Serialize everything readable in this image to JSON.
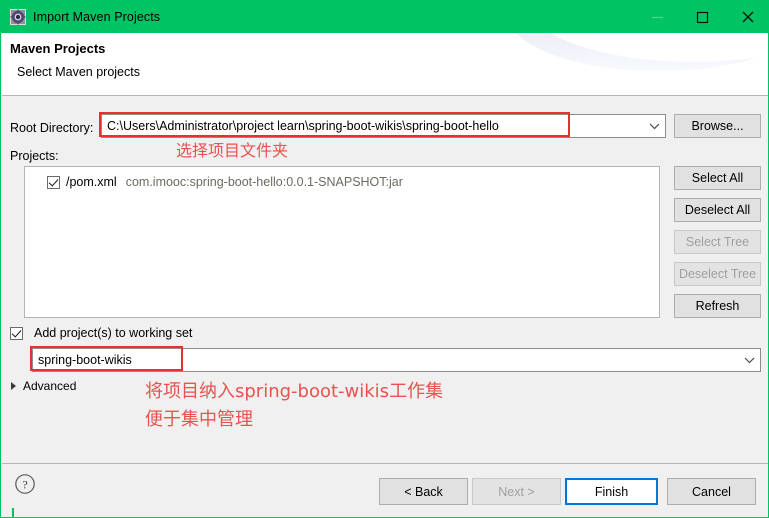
{
  "window": {
    "title": "Import Maven Projects",
    "icon": "maven-gear-icon",
    "accent_color": "#00c364",
    "controls": {
      "minimize": "–",
      "maximize": "□",
      "close": "×"
    }
  },
  "header": {
    "title": "Maven Projects",
    "subtitle": "Select Maven projects"
  },
  "form": {
    "root_directory_label": "Root Directory:",
    "root_directory_value": "C:\\Users\\Administrator\\project learn\\spring-boot-wikis\\spring-boot-hello",
    "root_directory_placeholder": "",
    "browse_label": "Browse...",
    "projects_label": "Projects:",
    "project_rows": [
      {
        "checked": true,
        "name": "/pom.xml",
        "coordinates": "com.imooc:spring-boot-hello:0.0.1-SNAPSHOT:jar"
      }
    ],
    "side_buttons": [
      {
        "label": "Select All",
        "enabled": true
      },
      {
        "label": "Deselect All",
        "enabled": true
      },
      {
        "label": "Select Tree",
        "enabled": false
      },
      {
        "label": "Deselect Tree",
        "enabled": false
      },
      {
        "label": "Refresh",
        "enabled": true
      }
    ],
    "working_set_checkbox_label": "Add project(s) to working set",
    "working_set_checked": true,
    "working_set_value": "spring-boot-wikis",
    "advanced_label": "Advanced"
  },
  "annotations": [
    {
      "text": "选择项目文件夹",
      "color": "#e8524f"
    },
    {
      "text": "将项目纳入spring-boot-wikis工作集",
      "color": "#e8524f"
    },
    {
      "text": "便于集中管理",
      "color": "#e8524f"
    }
  ],
  "footer": {
    "help_icon": "help-circle-icon",
    "buttons": [
      {
        "label": "< Back",
        "enabled": true,
        "default": false
      },
      {
        "label": "Next >",
        "enabled": false,
        "default": false
      },
      {
        "label": "Finish",
        "enabled": true,
        "default": true
      },
      {
        "label": "Cancel",
        "enabled": true,
        "default": false
      }
    ]
  }
}
